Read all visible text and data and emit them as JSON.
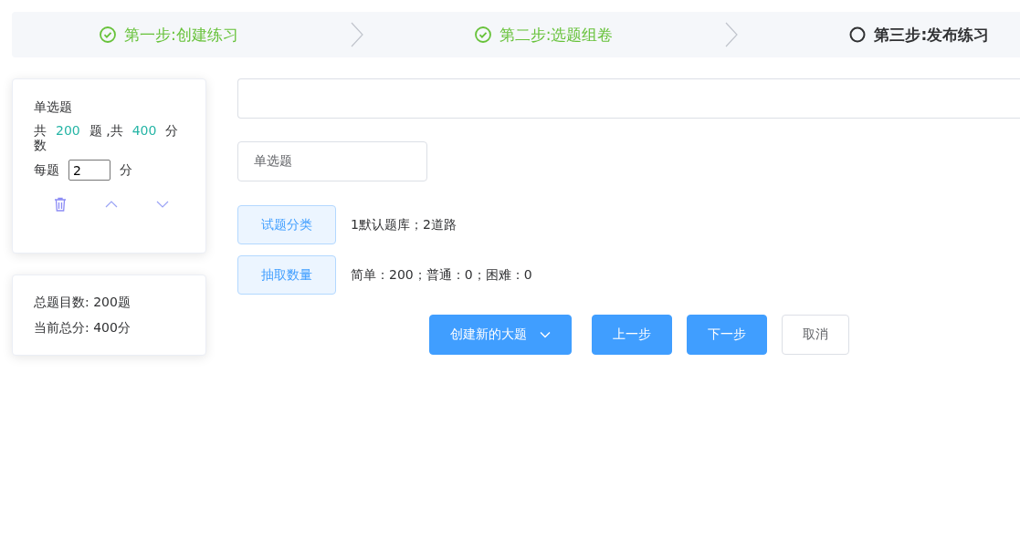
{
  "steps": [
    {
      "label": "第一步:创建练习",
      "done": true
    },
    {
      "label": "第二步:选题组卷",
      "done": true
    },
    {
      "label": "第三步:发布练习",
      "done": false
    }
  ],
  "question_card": {
    "title": "单选题",
    "summary": {
      "prefix": "共",
      "count": "200",
      "middle": "题 ,共",
      "score": "400",
      "suffix": "分数"
    },
    "per_label": "每题",
    "per_value": "2",
    "per_unit": "分"
  },
  "totals": {
    "count_line": "总题目数: 200题",
    "score_line": "当前总分: 400分"
  },
  "section_type": {
    "value": "单选题"
  },
  "rules": [
    {
      "button": "试题分类",
      "text": "1默认题库；2道路"
    },
    {
      "button": "抽取数量",
      "text": "简单：200；普通：0；困难：0"
    }
  ],
  "actions": [
    {
      "label": "创建新的大题",
      "kind": "dropdown"
    },
    {
      "label": "上一步",
      "kind": "primary"
    },
    {
      "label": "下一步",
      "kind": "primary"
    },
    {
      "label": "取消",
      "kind": "plain"
    }
  ]
}
